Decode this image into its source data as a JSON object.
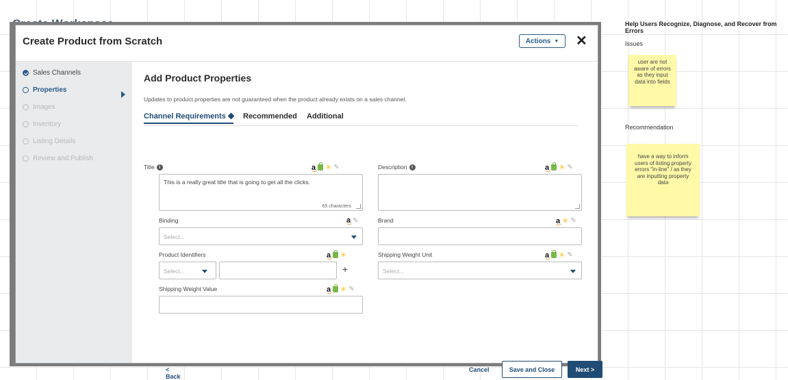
{
  "board": {
    "bg_title": "Create Workspace",
    "heading": "Help Users Recognize, Diagnose, and Recover from Errors",
    "issues_label": "Issues",
    "issue_note": "user are not aware of errors as they input data into fields",
    "recommendation_label": "Recommendation",
    "recommendation_note": "have a way to inform users of listing property errors \"in-line\" / as they are inputting property data",
    "note_color": "#fff9a8"
  },
  "modal": {
    "title": "Create Product from Scratch",
    "actions_label": "Actions",
    "close_icon": "close-icon"
  },
  "steps": [
    {
      "label": "Sales Channels",
      "state": "done"
    },
    {
      "label": "Properties",
      "state": "active"
    },
    {
      "label": "Images",
      "state": "pending"
    },
    {
      "label": "Inventory",
      "state": "pending"
    },
    {
      "label": "Listing Details",
      "state": "pending"
    },
    {
      "label": "Review and Publish",
      "state": "pending"
    }
  ],
  "content": {
    "heading": "Add Product Properties",
    "subtext": "Updates to product properties are not guaranteed when the product already exists on a sales channel.",
    "tabs": [
      {
        "label": "Channel Requirements",
        "active": true
      },
      {
        "label": "Recommended",
        "active": false
      },
      {
        "label": "Additional",
        "active": false
      }
    ]
  },
  "fields": {
    "title": {
      "label": "Title",
      "value": "This is a really great title that is going to get all the clicks.",
      "char_count": "65 characters"
    },
    "description": {
      "label": "Description",
      "value": ""
    },
    "binding": {
      "label": "Binding",
      "placeholder": "Select..."
    },
    "brand": {
      "label": "Brand",
      "value": ""
    },
    "product_identifiers": {
      "label": "Product Identifiers",
      "placeholder": "Select...",
      "value": ""
    },
    "shipping_weight_unit": {
      "label": "Shipping Weight Unit",
      "placeholder": "Select..."
    },
    "shipping_weight_value": {
      "label": "Shipping Weight Value",
      "value": ""
    }
  },
  "footer": {
    "back": "< Back",
    "cancel": "Cancel",
    "save_close": "Save and Close",
    "next": "Next >"
  },
  "colors": {
    "primary": "#1f4c74",
    "sidebar": "#e9ebed"
  }
}
